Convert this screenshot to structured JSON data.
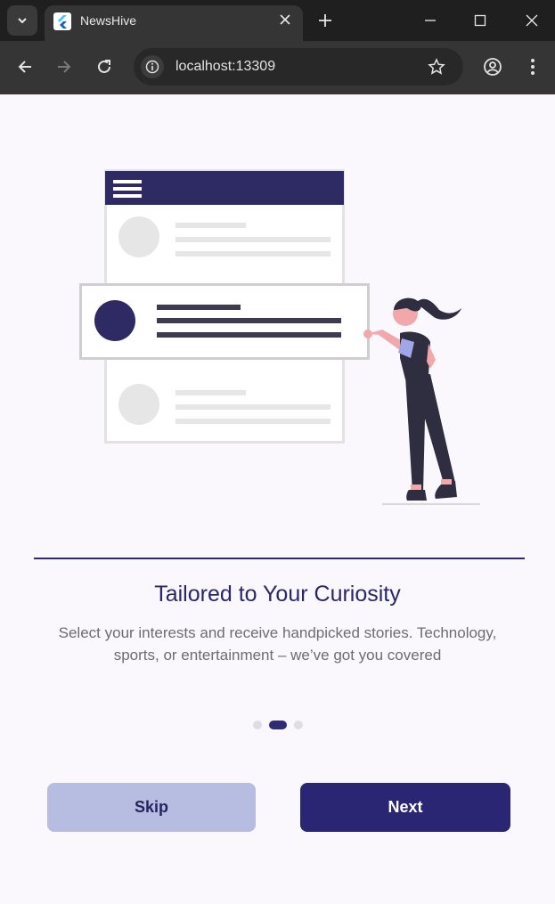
{
  "browser": {
    "tab_title": "NewsHive",
    "url": "localhost:13309"
  },
  "onboarding": {
    "headline": "Tailored to Your Curiosity",
    "description": "Select your interests and receive handpicked stories. Technology, sports, or entertainment – we’ve got you covered",
    "page_indicator": {
      "count": 3,
      "active_index": 1
    },
    "skip_label": "Skip",
    "next_label": "Next"
  },
  "colors": {
    "primary": "#2b2674",
    "secondary": "#b7bde1",
    "background": "#faf7fd"
  }
}
